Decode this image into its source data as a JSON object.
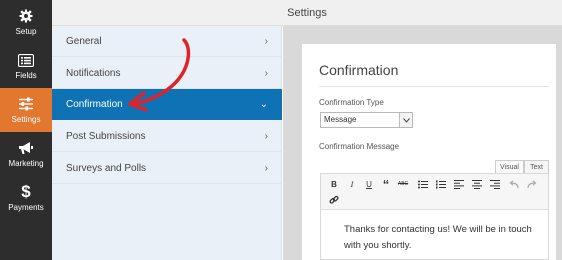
{
  "topbar": {
    "title": "Settings"
  },
  "sidebar": {
    "items": [
      {
        "label": "Setup",
        "icon": "gear-icon"
      },
      {
        "label": "Fields",
        "icon": "list-form-icon"
      },
      {
        "label": "Settings",
        "icon": "sliders-icon",
        "active": true
      },
      {
        "label": "Marketing",
        "icon": "megaphone-icon"
      },
      {
        "label": "Payments",
        "icon": "dollar-icon"
      }
    ]
  },
  "settings_nav": {
    "items": [
      {
        "label": "General"
      },
      {
        "label": "Notifications"
      },
      {
        "label": "Confirmation",
        "active": true
      },
      {
        "label": "Post Submissions"
      },
      {
        "label": "Surveys and Polls"
      }
    ]
  },
  "confirmation": {
    "title": "Confirmation",
    "type_label": "Confirmation Type",
    "type_value": "Message",
    "message_label": "Confirmation Message",
    "tab_visual": "Visual",
    "tab_text": "Text",
    "message_text": "Thanks for contacting us! We will be in touch with you shortly."
  },
  "toolbar": {
    "bold": "B",
    "italic": "I",
    "underline": "U",
    "quote": "“",
    "strike": "ABC"
  },
  "colors": {
    "sidebar_bg": "#2d2d2d",
    "sidebar_active": "#e27730",
    "nav_bg": "#eaf0f7",
    "nav_active": "#0e72b5",
    "annotation_arrow": "#e0232a"
  }
}
